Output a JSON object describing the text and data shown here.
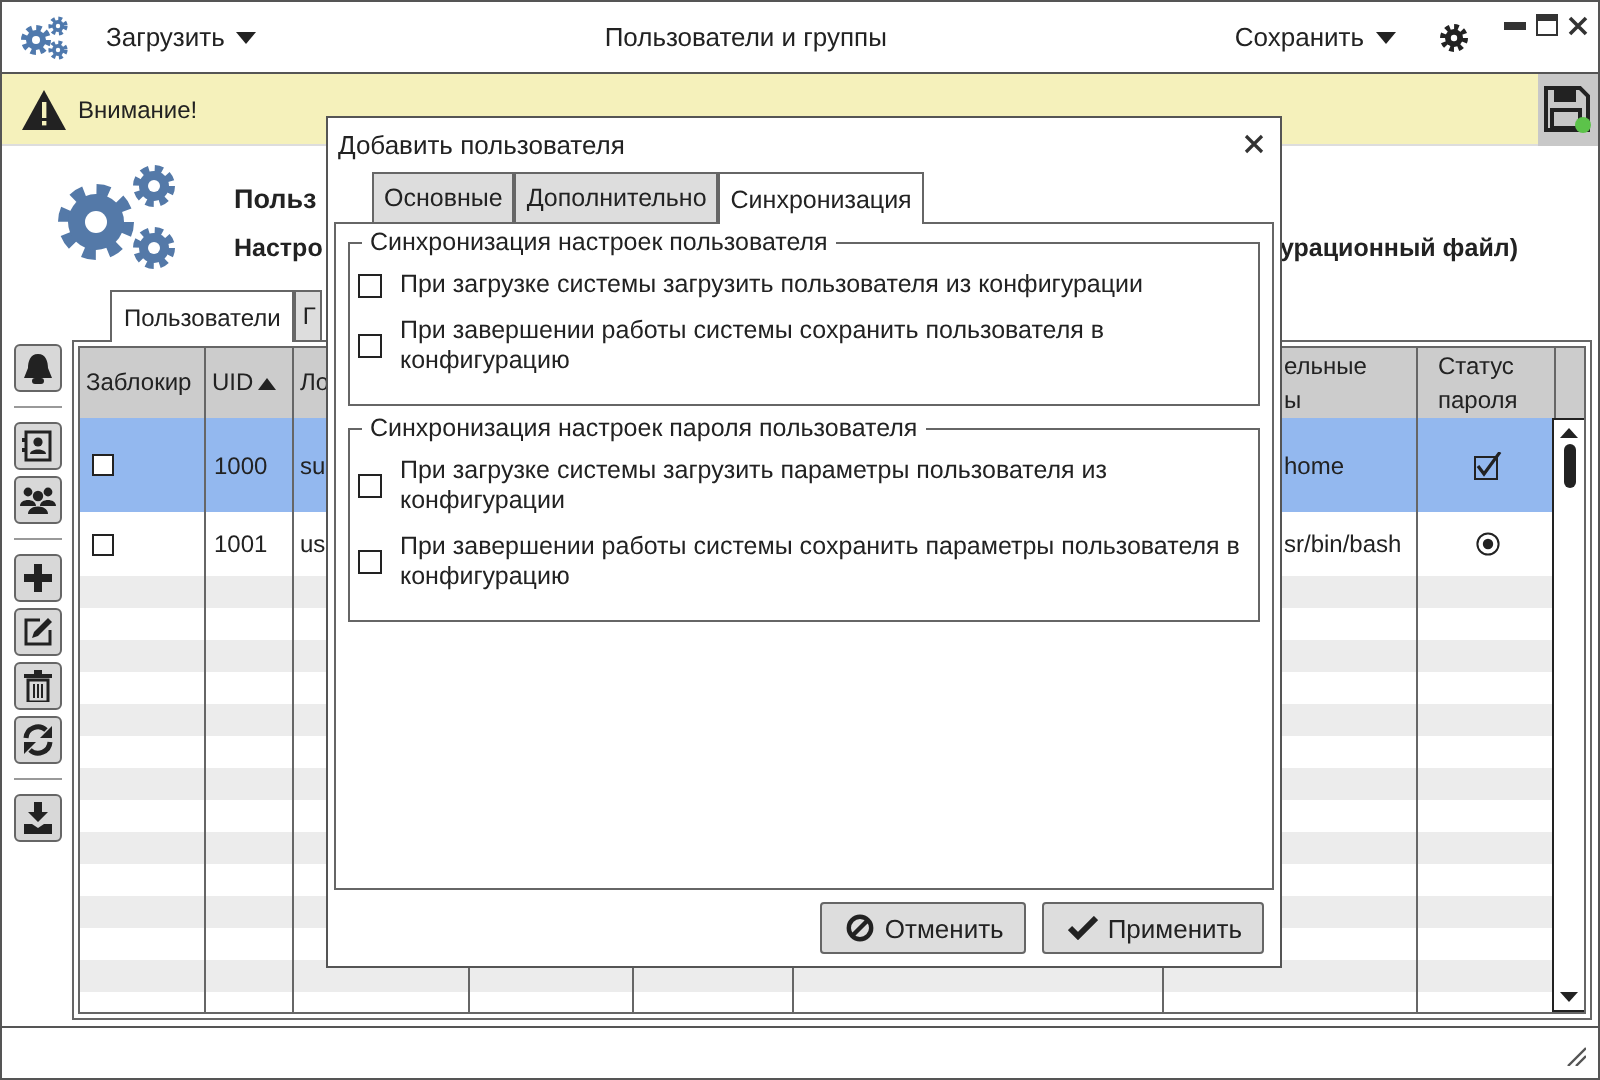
{
  "toolbar": {
    "load_menu": "Загрузить",
    "title": "Пользователи и группы",
    "save_menu": "Сохранить"
  },
  "warning": {
    "text": "Внимание!"
  },
  "header": {
    "title": "Польз",
    "subtitle_start": "Настро",
    "subtitle_end": "урационный файл)"
  },
  "tabs": [
    {
      "label": "Пользователи",
      "selected": true
    },
    {
      "label": "Г",
      "selected": false
    }
  ],
  "table": {
    "columns": [
      {
        "lines": [
          "Заблокир"
        ]
      },
      {
        "lines": [
          "UID"
        ],
        "sorted": true
      },
      {
        "lines": [
          "Ло"
        ]
      },
      {
        "lines": [
          "ельные",
          "ы"
        ]
      },
      {
        "lines": [
          "Статус",
          "пароля"
        ]
      }
    ],
    "rows": [
      {
        "selected": true,
        "locked": false,
        "uid": "1000",
        "login": "su",
        "column_7": "home",
        "password_status": {
          "kind": "checkbox",
          "checked": true
        }
      },
      {
        "selected": false,
        "locked": false,
        "uid": "1001",
        "login": "us",
        "column_7": "sr/bin/bash",
        "password_status": {
          "kind": "radio",
          "checked": true
        }
      }
    ]
  },
  "dialog": {
    "title": "Добавить пользователя",
    "tabs": [
      {
        "label": "Основные",
        "selected": false
      },
      {
        "label": "Дополнительно",
        "selected": false
      },
      {
        "label": "Синхронизация",
        "selected": true
      }
    ],
    "groups": [
      {
        "title": "Синхронизация настроек пользователя",
        "options": [
          {
            "label": "При загрузке системы загрузить пользователя из конфигурации",
            "checked": false
          },
          {
            "label": "При завершении работы системы сохранить пользователя в конфигурацию",
            "checked": false
          }
        ]
      },
      {
        "title": "Синхронизация настроек пароля пользователя",
        "options": [
          {
            "label": "При загрузке системы загрузить параметры пользователя из конфигурации",
            "checked": false
          },
          {
            "label": "При завершении работы системы сохранить параметры пользователя в конфигурацию",
            "checked": false
          }
        ]
      }
    ],
    "buttons": [
      {
        "kind": "cancel",
        "label": "Отменить"
      },
      {
        "kind": "apply",
        "label": "Применить"
      }
    ]
  }
}
